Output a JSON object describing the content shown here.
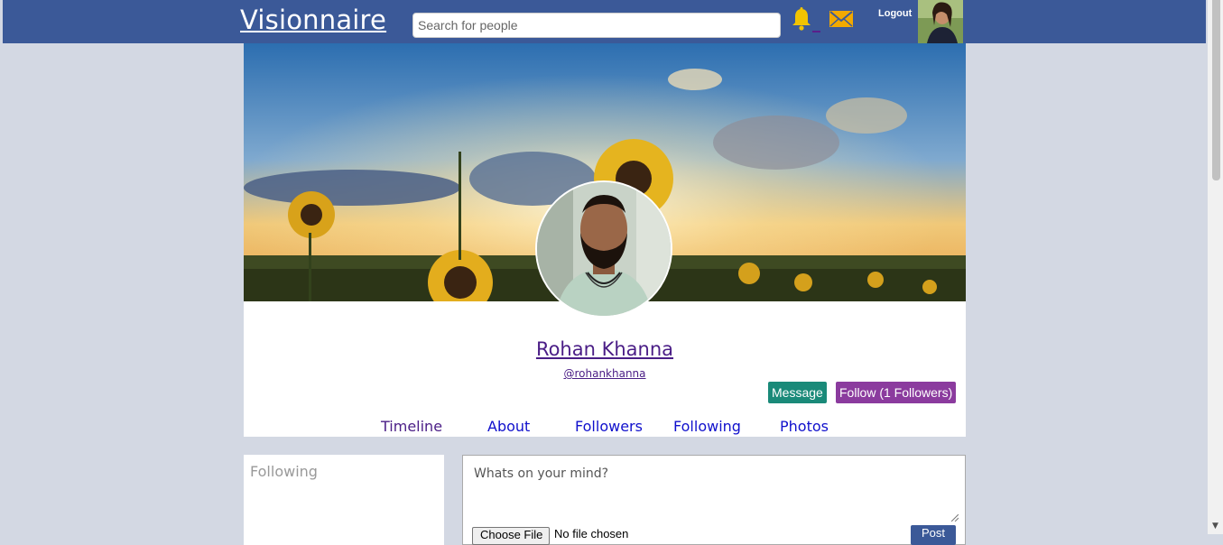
{
  "header": {
    "logo": "Visionnaire",
    "search_placeholder": "Search for people",
    "logout_label": "Logout",
    "accent_color": "#3b5998",
    "icons": [
      "bell-icon",
      "mail-icon"
    ]
  },
  "profile": {
    "name": "Rohan Khanna",
    "handle": "@rohankhanna",
    "message_label": "Message",
    "follow_label": "Follow (1 Followers)"
  },
  "tabs": [
    "Timeline",
    "About",
    "Followers",
    "Following",
    "Photos"
  ],
  "sidebar": {
    "title": "Following"
  },
  "composer": {
    "placeholder": "Whats on your mind?",
    "choose_file_label": "Choose File",
    "no_file_label": "No file chosen",
    "post_label": "Post"
  }
}
